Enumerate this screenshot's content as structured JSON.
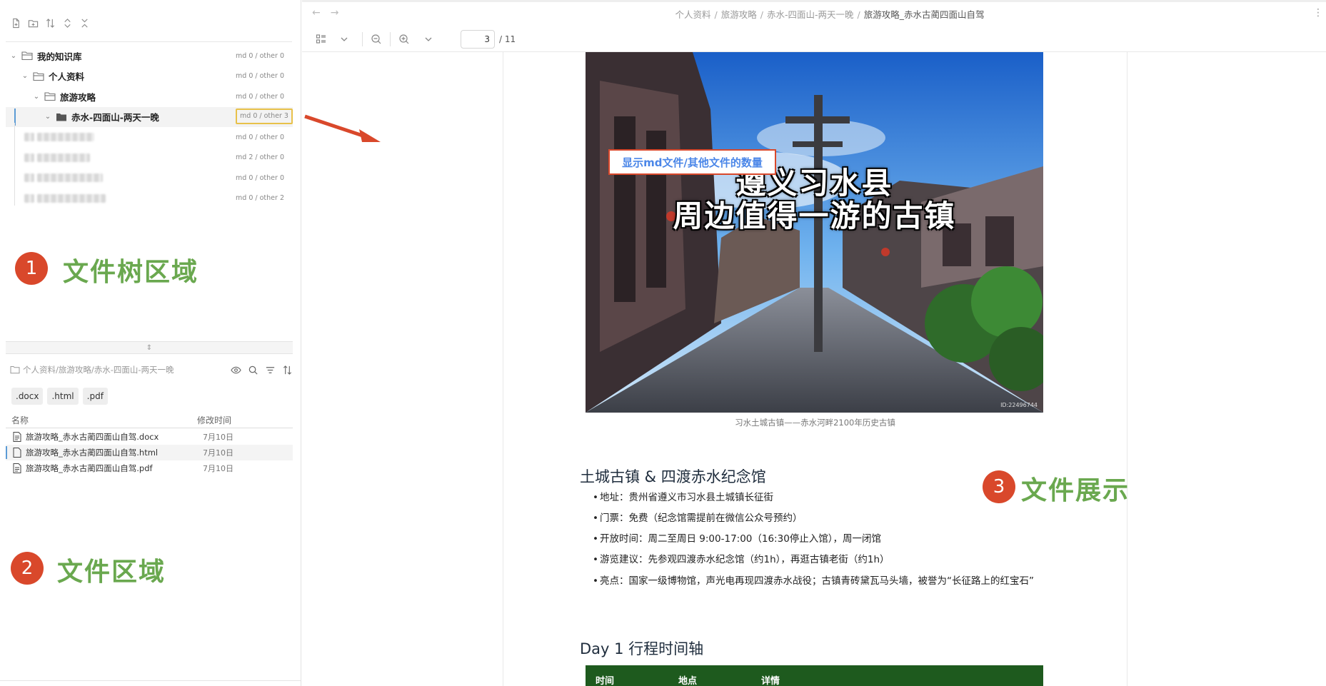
{
  "sidebar": {
    "toolbar_icons": [
      "new-file-icon",
      "new-folder-icon",
      "sort-icon",
      "expand-icon",
      "collapse-icon"
    ],
    "tree": [
      {
        "label": "我的知识库",
        "count": "md 0 / other 0"
      },
      {
        "label": "个人资料",
        "count": "md 0 / other 0"
      },
      {
        "label": "旅游攻略",
        "count": "md 0 / other 0"
      },
      {
        "label": "赤水-四面山-两天一晚",
        "count": "md 0 / other 3"
      },
      {
        "count": "md 0 / other 0"
      },
      {
        "count": "md 2 / other 0"
      },
      {
        "count": "md 0 / other 0"
      },
      {
        "count": "md 0 / other 2"
      }
    ],
    "callout1": {
      "num": "1",
      "text": "文件树区域"
    },
    "callout2": {
      "num": "2",
      "text": "文件区域"
    },
    "path": "个人资料/旅游攻略/赤水-四面山-两天一晚",
    "ext_filters": [
      ".docx",
      ".html",
      ".pdf"
    ],
    "file_headers": {
      "name": "名称",
      "modified": "修改时间"
    },
    "files": [
      {
        "name": "旅游攻略_赤水古蔺四面山自驾.docx",
        "date": "7月10日"
      },
      {
        "name": "旅游攻略_赤水古蔺四面山自驾.html",
        "date": "7月10日"
      },
      {
        "name": "旅游攻略_赤水古蔺四面山自驾.pdf",
        "date": "7月10日"
      }
    ]
  },
  "viewer": {
    "breadcrumb": [
      "个人资料",
      "旅游攻略",
      "赤水-四面山-两天一晚",
      "旅游攻略_赤水古蔺四面山自驾"
    ],
    "page_current": "3",
    "page_total": "/ 11",
    "annotation": "显示md文件/其他文件的数量",
    "callout3": {
      "num": "3",
      "text": "文件展示"
    },
    "doc": {
      "photo_title_line1": "遵义习水县",
      "photo_title_line2": "周边值得一游的古镇",
      "photo_id": "ID:22496744",
      "caption": "习水土城古镇——赤水河畔2100年历史古镇",
      "section1_title": "土城古镇 & 四渡赤水纪念馆",
      "bullets": [
        "地址：贵州省遵义市习水县土城镇长征街",
        "门票：免费（纪念馆需提前在微信公众号预约）",
        "开放时间：周二至周日 9:00-17:00（16:30停止入馆），周一闭馆",
        "游览建议：先参观四渡赤水纪念馆（约1h），再逛古镇老街（约1h）",
        "亮点：国家一级博物馆，声光电再现四渡赤水战役；古镇青砖黛瓦马头墙，被誉为“长征路上的红宝石”"
      ],
      "section2_title": "Day 1 行程时间轴",
      "table_headers": [
        "时间",
        "地点",
        "详情"
      ]
    }
  },
  "colors": {
    "accent_red": "#d9482b",
    "callout_green": "#6aa84f",
    "annotation_blue": "#4a86e8",
    "table_green": "#1e5a1e",
    "highlight_yellow": "#e8c14a"
  }
}
